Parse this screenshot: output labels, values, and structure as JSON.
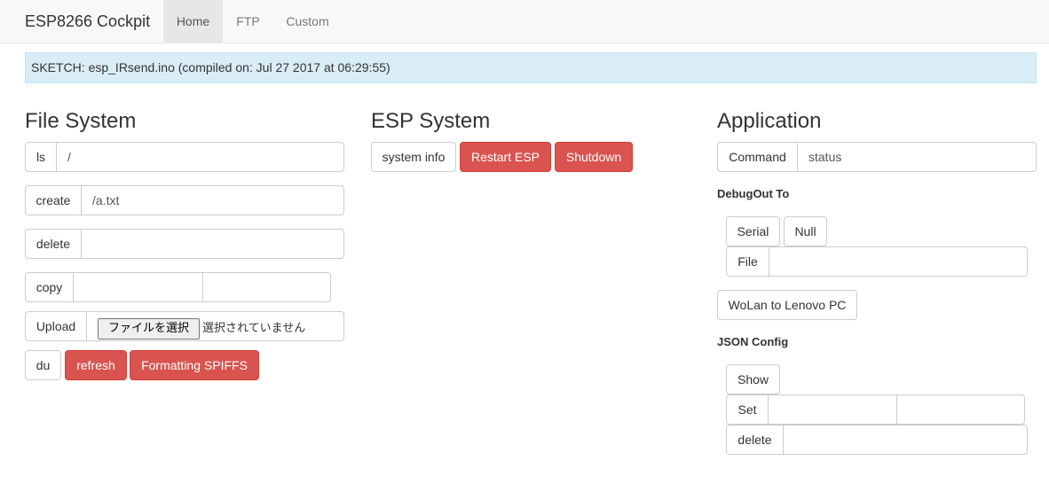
{
  "navbar": {
    "brand": "ESP8266 Cockpit",
    "tabs": [
      {
        "label": "Home"
      },
      {
        "label": "FTP"
      },
      {
        "label": "Custom"
      }
    ]
  },
  "alert": {
    "text": "SKETCH: esp_IRsend.ino (compiled on: Jul 27 2017 at 06:29:55)"
  },
  "file_system": {
    "title": "File System",
    "ls": {
      "label": "ls",
      "value": "/"
    },
    "create": {
      "label": "create",
      "value": "/a.txt"
    },
    "delete": {
      "label": "delete",
      "value": ""
    },
    "copy": {
      "label": "copy",
      "from": "",
      "to": ""
    },
    "upload": {
      "label": "Upload",
      "button": "ファイルを選択",
      "status": "選択されていません"
    },
    "du_label": "du",
    "refresh_label": "refresh",
    "format_label": "Formatting SPIFFS"
  },
  "esp_system": {
    "title": "ESP System",
    "system_info_label": "system info",
    "restart_label": "Restart ESP",
    "shutdown_label": "Shutdown"
  },
  "application": {
    "title": "Application",
    "command": {
      "label": "Command",
      "value": "status"
    },
    "debugout": {
      "heading": "DebugOut To",
      "serial_label": "Serial",
      "null_label": "Null",
      "file": {
        "label": "File",
        "value": ""
      }
    },
    "wolan_label": "WoLan to Lenovo PC",
    "json_config": {
      "heading": "JSON Config",
      "show_label": "Show",
      "set": {
        "label": "Set",
        "key": "",
        "value": ""
      },
      "delete": {
        "label": "delete",
        "value": ""
      }
    }
  },
  "colors": {
    "danger": "#d9534f",
    "alert_bg": "#d9edf7",
    "navbar_bg": "#f8f8f8"
  }
}
